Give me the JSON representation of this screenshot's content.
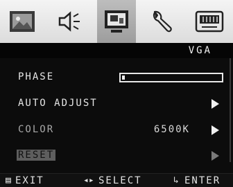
{
  "osd": {
    "source_title": "VGA",
    "tabs": [
      {
        "id": "picture",
        "icon": "picture-icon",
        "active": false
      },
      {
        "id": "audio",
        "icon": "speaker-icon",
        "active": false
      },
      {
        "id": "screen",
        "icon": "monitor-icon",
        "active": true
      },
      {
        "id": "tools",
        "icon": "wrench-icon",
        "active": false
      },
      {
        "id": "setup",
        "icon": "display-setup-icon",
        "active": false
      }
    ],
    "menu": {
      "phase": {
        "label": "PHASE",
        "level": 0.02
      },
      "auto_adjust": {
        "label": "AUTO ADJUST"
      },
      "color": {
        "label": "COLOR",
        "value": "6500K"
      },
      "reset": {
        "label": "RESET",
        "selected": true
      }
    },
    "hints": {
      "exit": "EXIT",
      "select": "SELECT",
      "enter": "ENTER"
    }
  }
}
